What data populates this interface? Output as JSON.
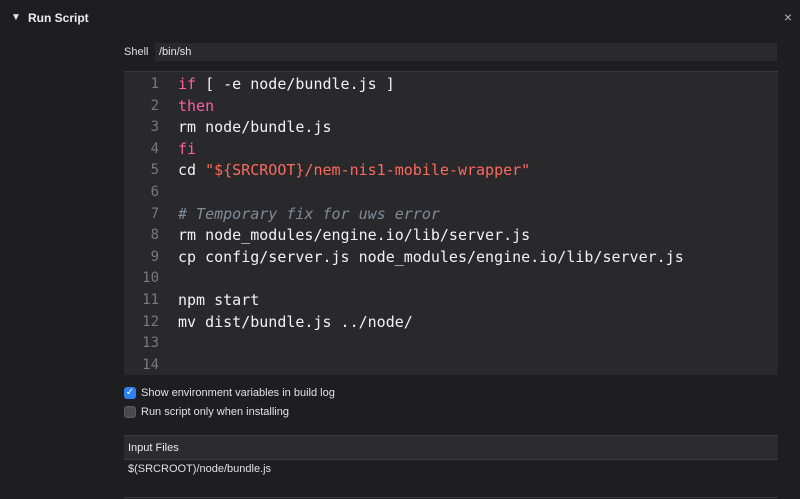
{
  "phase": {
    "disclosure_glyph": "▼",
    "title": "Run Script",
    "close_glyph": "×"
  },
  "shell": {
    "label": "Shell",
    "value": "/bin/sh"
  },
  "script": {
    "lines": [
      {
        "num": "1",
        "tokens": [
          {
            "t": "if",
            "c": "kw"
          },
          {
            "t": " [ -e node/bundle.js ]",
            "c": ""
          }
        ]
      },
      {
        "num": "2",
        "tokens": [
          {
            "t": "then",
            "c": "kw"
          }
        ]
      },
      {
        "num": "3",
        "tokens": [
          {
            "t": "rm node/bundle.js",
            "c": ""
          }
        ]
      },
      {
        "num": "4",
        "tokens": [
          {
            "t": "fi",
            "c": "kw"
          }
        ]
      },
      {
        "num": "5",
        "tokens": [
          {
            "t": "cd ",
            "c": ""
          },
          {
            "t": "\"${SRCROOT}/nem-nis1-mobile-wrapper\"",
            "c": "str"
          }
        ]
      },
      {
        "num": "6",
        "tokens": []
      },
      {
        "num": "7",
        "tokens": [
          {
            "t": "# Temporary fix for uws error",
            "c": "cmt"
          }
        ]
      },
      {
        "num": "8",
        "tokens": [
          {
            "t": "rm node_modules/engine.io/lib/server.js",
            "c": ""
          }
        ]
      },
      {
        "num": "9",
        "tokens": [
          {
            "t": "cp config/server.js node_modules/engine.io/lib/server.js",
            "c": ""
          }
        ]
      },
      {
        "num": "10",
        "tokens": []
      },
      {
        "num": "11",
        "tokens": [
          {
            "t": "npm start",
            "c": ""
          }
        ]
      },
      {
        "num": "12",
        "tokens": [
          {
            "t": "mv dist/bundle.js ../node/",
            "c": ""
          }
        ]
      },
      {
        "num": "13",
        "tokens": []
      },
      {
        "num": "14",
        "tokens": []
      }
    ]
  },
  "options": {
    "show_env": {
      "label": "Show environment variables in build log",
      "checked": true
    },
    "install_only": {
      "label": "Run script only when installing",
      "checked": false
    },
    "check_glyph": "✓"
  },
  "input_files": {
    "title": "Input Files",
    "items": [
      "$(SRCROOT)/node/bundle.js"
    ]
  }
}
